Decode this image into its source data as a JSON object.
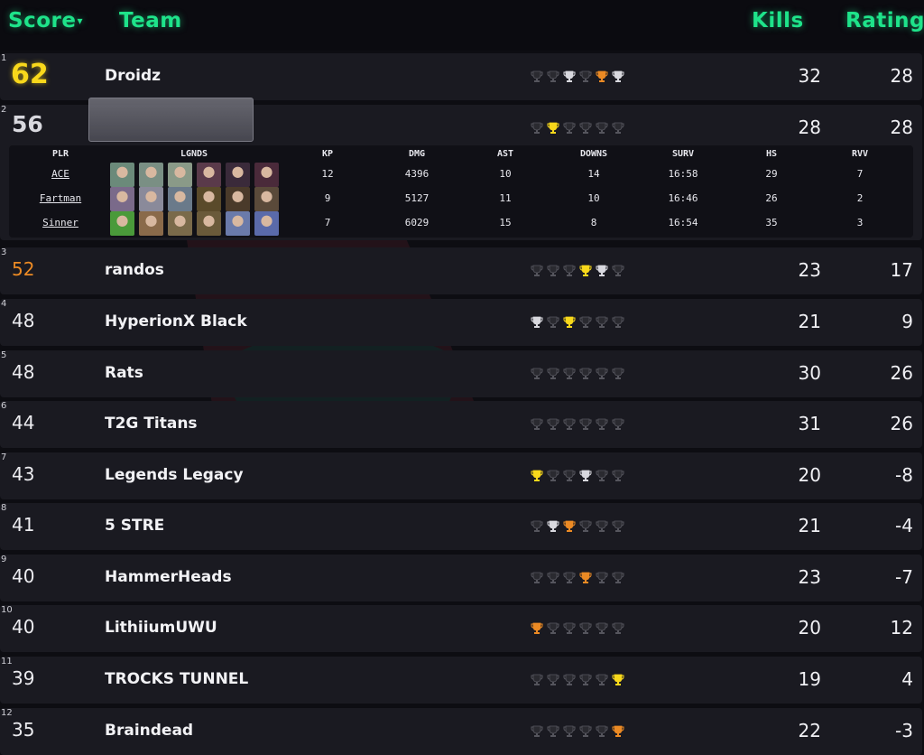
{
  "header": {
    "score_label": "Score",
    "sort_indicator": "▾",
    "team_label": "Team",
    "kills_label": "Kills",
    "rating_label": "Rating"
  },
  "colors": {
    "accent": "#1ee38a",
    "gold": "#f8d81b",
    "silver": "#d8d8de",
    "bronze": "#eb8a24",
    "trophy_dark": "#2a2a30",
    "row_bg": "#1a1a21"
  },
  "teams": [
    {
      "rank": "1",
      "score": "62",
      "team": "Droidz",
      "kills": "32",
      "rating": "28",
      "trophies": [
        "none",
        "none",
        "silver",
        "none",
        "bronze",
        "silver"
      ]
    },
    {
      "rank": "2",
      "score": "56",
      "team": "",
      "kills": "28",
      "rating": "28",
      "trophies": [
        "none",
        "gold",
        "none",
        "none",
        "none",
        "none"
      ]
    },
    {
      "rank": "3",
      "score": "52",
      "team": "randos",
      "kills": "23",
      "rating": "17",
      "trophies": [
        "none",
        "none",
        "none",
        "gold",
        "silver",
        "none"
      ]
    },
    {
      "rank": "4",
      "score": "48",
      "team": "HyperionX Black",
      "kills": "21",
      "rating": "9",
      "trophies": [
        "silver",
        "none",
        "gold",
        "none",
        "none",
        "none"
      ]
    },
    {
      "rank": "5",
      "score": "48",
      "team": "Rats",
      "kills": "30",
      "rating": "26",
      "trophies": [
        "none",
        "none",
        "none",
        "none",
        "none",
        "none"
      ]
    },
    {
      "rank": "6",
      "score": "44",
      "team": "T2G Titans",
      "kills": "31",
      "rating": "26",
      "trophies": [
        "none",
        "none",
        "none",
        "none",
        "none",
        "none"
      ]
    },
    {
      "rank": "7",
      "score": "43",
      "team": "Legends Legacy",
      "kills": "20",
      "rating": "-8",
      "trophies": [
        "gold",
        "none",
        "none",
        "silver",
        "none",
        "none"
      ]
    },
    {
      "rank": "8",
      "score": "41",
      "team": "5 STRE",
      "kills": "21",
      "rating": "-4",
      "trophies": [
        "none",
        "silver",
        "bronze",
        "none",
        "none",
        "none"
      ]
    },
    {
      "rank": "9",
      "score": "40",
      "team": "HammerHeads",
      "kills": "23",
      "rating": "-7",
      "trophies": [
        "none",
        "none",
        "none",
        "bronze",
        "none",
        "none"
      ]
    },
    {
      "rank": "10",
      "score": "40",
      "team": "LithiiumUWU",
      "kills": "20",
      "rating": "12",
      "trophies": [
        "bronze",
        "none",
        "none",
        "none",
        "none",
        "none"
      ]
    },
    {
      "rank": "11",
      "score": "39",
      "team": "TROCKS TUNNEL",
      "kills": "19",
      "rating": "4",
      "trophies": [
        "none",
        "none",
        "none",
        "none",
        "none",
        "gold"
      ]
    },
    {
      "rank": "12",
      "score": "35",
      "team": "Braindead",
      "kills": "22",
      "rating": "-3",
      "trophies": [
        "none",
        "none",
        "none",
        "none",
        "none",
        "bronze"
      ]
    }
  ],
  "details": {
    "headers": {
      "plr": "PLR",
      "lgnds": "LGNDS",
      "kp": "KP",
      "dmg": "DMG",
      "ast": "AST",
      "downs": "DOWNS",
      "surv": "SURV",
      "hs": "HS",
      "rvv": "RVV"
    },
    "players": [
      {
        "name": "ACE",
        "kp": "12",
        "dmg": "4396",
        "ast": "10",
        "downs": "14",
        "surv": "16:58",
        "hs": "29",
        "rvv": "7",
        "legend_colors": [
          "#6b8a7a",
          "#7a8f84",
          "#8a9a88",
          "#5a3a4a",
          "#3a2a3a",
          "#4a2a3a"
        ]
      },
      {
        "name": "Fartman",
        "kp": "9",
        "dmg": "5127",
        "ast": "11",
        "downs": "10",
        "surv": "16:46",
        "hs": "26",
        "rvv": "2",
        "legend_colors": [
          "#7a6a8a",
          "#8a8a9a",
          "#6a7a8a",
          "#5a4a2a",
          "#4a3a2a",
          "#5a4a3a"
        ]
      },
      {
        "name": "Sinner",
        "kp": "7",
        "dmg": "6029",
        "ast": "15",
        "downs": "8",
        "surv": "16:54",
        "hs": "35",
        "rvv": "3",
        "legend_colors": [
          "#4a9a3a",
          "#8a6a4a",
          "#7a6a4a",
          "#6a5a3a",
          "#6a7aaa",
          "#5a6aaa"
        ]
      }
    ]
  }
}
